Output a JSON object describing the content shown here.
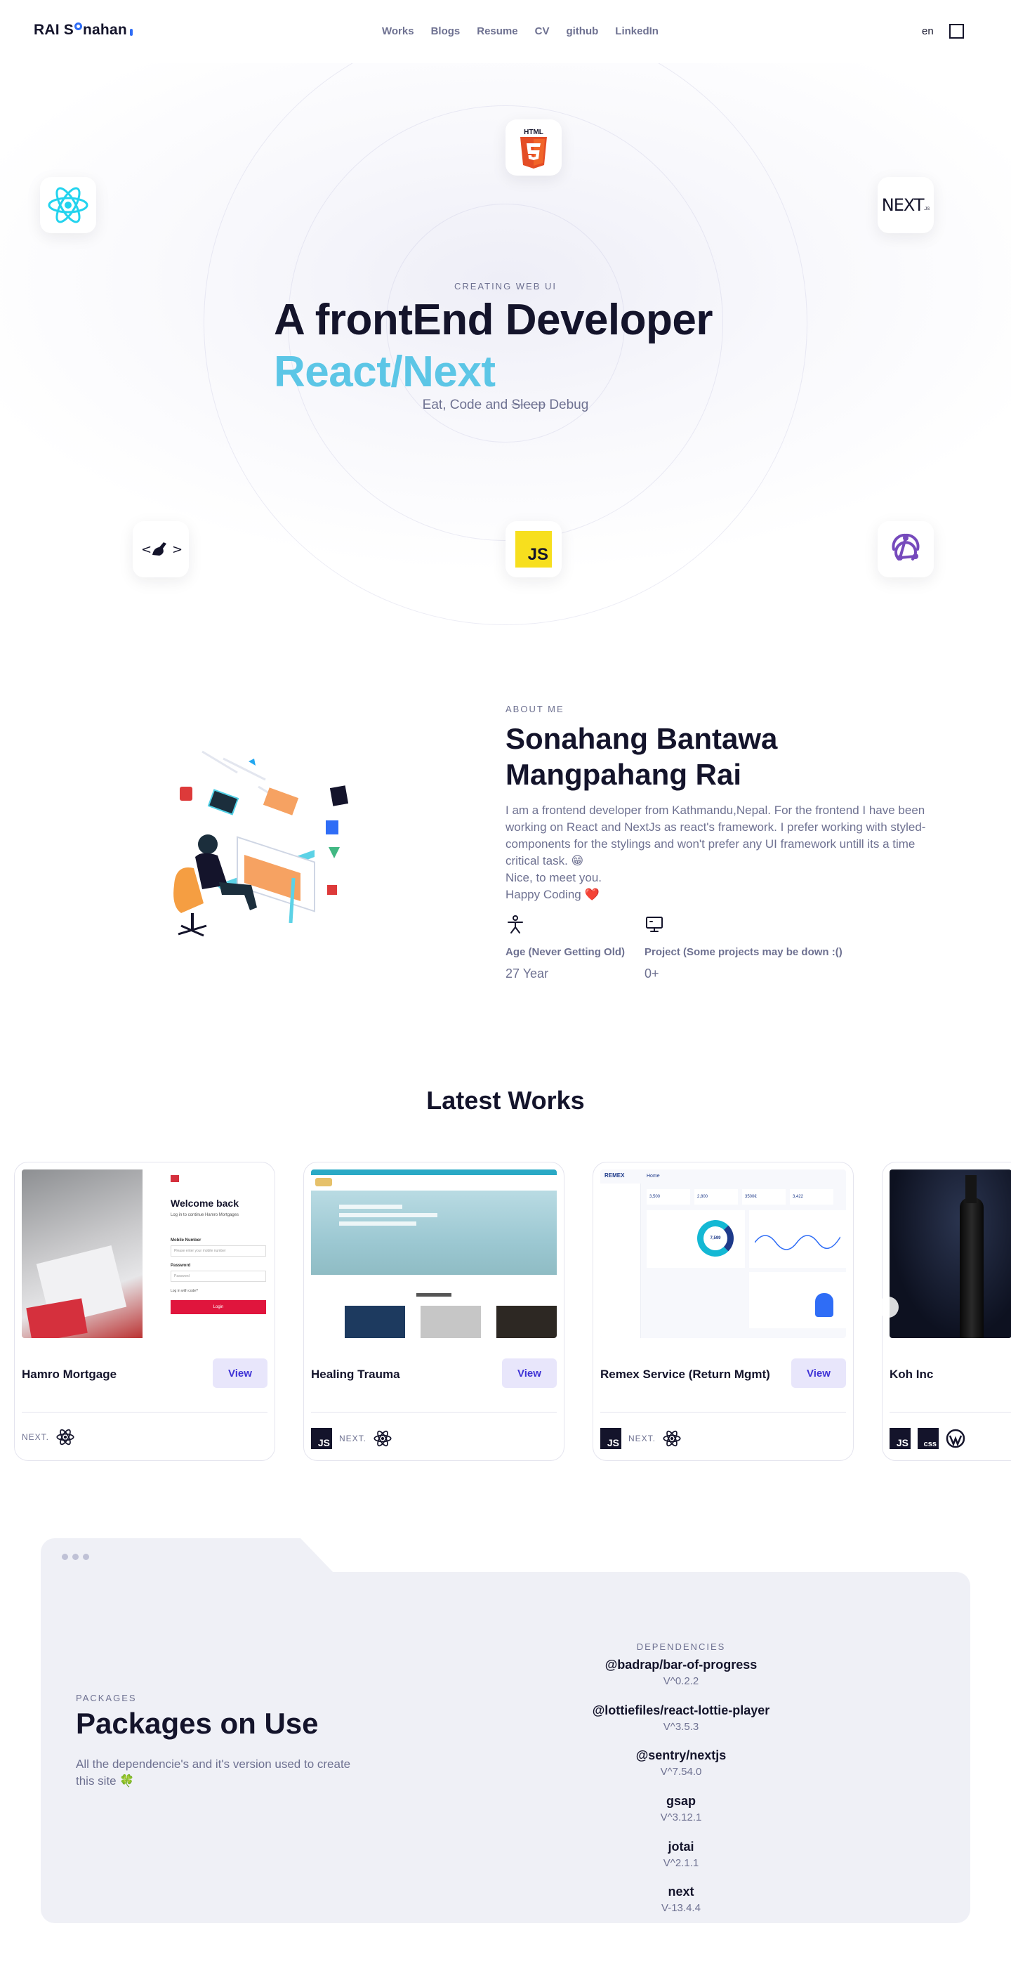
{
  "nav": {
    "logo": {
      "part1": "RAI S",
      "part2": "nahan"
    },
    "links": [
      "Works",
      "Blogs",
      "Resume",
      "CV",
      "github",
      "LinkedIn"
    ],
    "lang": "en"
  },
  "hero": {
    "eyebrow": "CREATING WEB UI",
    "title": "A frontEnd Developer",
    "subtitle": "React/Next",
    "tagline_pre": "Eat, Code and ",
    "tagline_struck": "Sleep",
    "tagline_post": " Debug",
    "html5_label": "HTML",
    "next_label": "NEXT",
    "js_label": "JS"
  },
  "about": {
    "eyebrow": "ABOUT ME",
    "name": "Sonahang Bantawa Mangpahang Rai",
    "bio_1": "I am a frontend developer from Kathmandu,Nepal. For the frontend I have been working on React and NextJs as react's framework. I prefer working with styled-components for the stylings and won't prefer any UI framework untill its a time critical task. 😁",
    "bio_2": "Nice, to meet you.",
    "bio_3": "Happy Coding ❤️",
    "stats": [
      {
        "label": "Age (Never Getting Old)",
        "value": "27 Year"
      },
      {
        "label": "Project (Some projects may be down :()",
        "value": "0+"
      }
    ]
  },
  "works": {
    "title": "Latest Works",
    "view_label": "View",
    "cards": [
      {
        "name": "Hamro Mortgage",
        "stack": [
          "nextjs-icon",
          "react-icon"
        ],
        "thumb_text": {
          "welcome": "Welcome back",
          "sub": "Log in to continue Hamro Mortgages",
          "mobile": "Mobile Number",
          "mobile_ph": "Please enter your mobile number",
          "password": "Password",
          "password_ph": "Password",
          "help": "Log in with code?",
          "login": "Login"
        }
      },
      {
        "name": "Healing Trauma",
        "stack": [
          "javascript-icon",
          "nextjs-icon",
          "react-icon"
        ]
      },
      {
        "name": "Remex Service (Return Mgmt)",
        "stack": [
          "javascript-icon",
          "nextjs-icon",
          "react-icon"
        ],
        "thumb_text": {
          "brand": "REMEX",
          "home": "Home",
          "stats": [
            "3,500",
            "2,800",
            "3500€",
            "3,422"
          ],
          "donut": "7,599"
        }
      },
      {
        "name": "Koh Inc",
        "stack": [
          "javascript-icon",
          "css-icon",
          "wordpress-icon"
        ]
      }
    ],
    "next_text": "NEXT."
  },
  "packages": {
    "eyebrow": "PACKAGES",
    "title": "Packages on Use",
    "desc": "All the dependencie's and it's version used to create this site 🍀",
    "deps_eyebrow": "DEPENDENCIES",
    "deps": [
      {
        "name": "@badrap/bar-of-progress",
        "version": "V^0.2.2"
      },
      {
        "name": "@lottiefiles/react-lottie-player",
        "version": "V^3.5.3"
      },
      {
        "name": "@sentry/nextjs",
        "version": "V^7.54.0"
      },
      {
        "name": "gsap",
        "version": "V^3.12.1"
      },
      {
        "name": "jotai",
        "version": "V^2.1.1"
      },
      {
        "name": "next",
        "version": "V-13.4.4"
      }
    ]
  },
  "colors": {
    "accent": "#5cc6e6",
    "text": "#14142b",
    "muted": "#6e7191",
    "button_bg": "#e8e6fb",
    "button_text": "#3f33d6",
    "panel": "#eff0f6"
  }
}
